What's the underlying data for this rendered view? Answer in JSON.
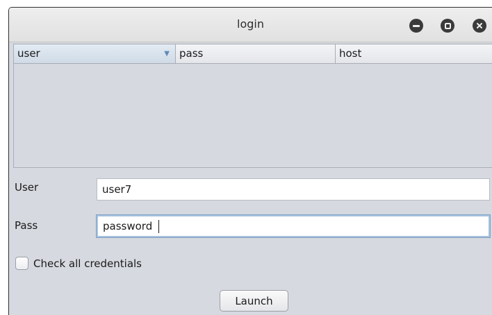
{
  "window": {
    "title": "login"
  },
  "table": {
    "columns": [
      "user",
      "pass",
      "host"
    ],
    "sort_column": "user",
    "rows": []
  },
  "form": {
    "user_label": "User",
    "user_value": "user7",
    "pass_label": "Pass",
    "pass_value": "password",
    "check_label": "Check all credentials",
    "check_checked": false,
    "launch_label": "Launch"
  },
  "icons": {
    "minimize": "minimize-icon",
    "maximize": "maximize-icon",
    "close": "close-icon",
    "sort": "sort-descending-icon"
  },
  "colors": {
    "window_bg": "#d6d9df",
    "header_selected": "#cfdbe7",
    "focus_border": "#7f9fc4"
  }
}
